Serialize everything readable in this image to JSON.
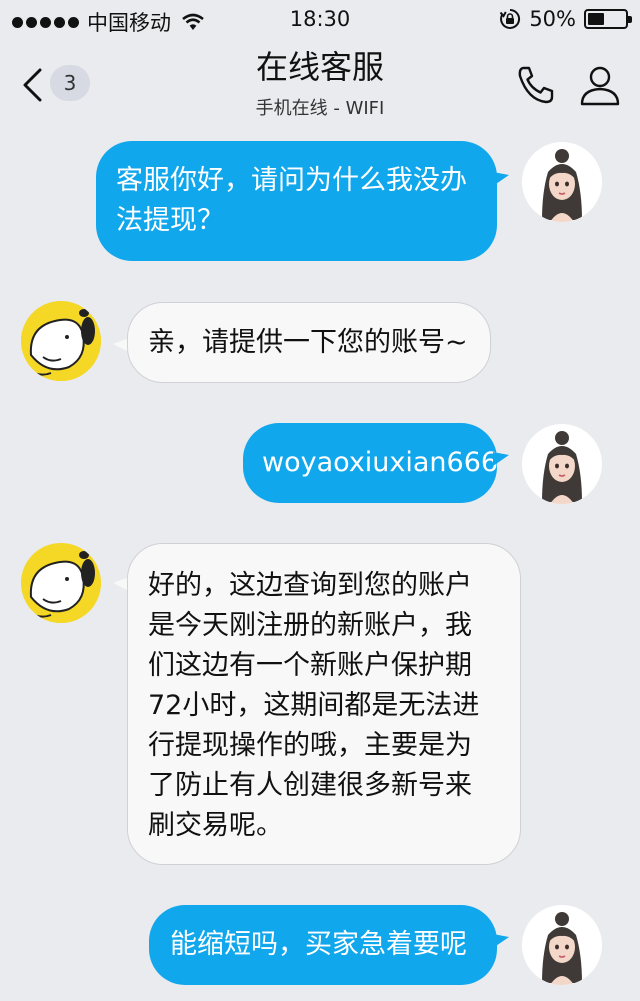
{
  "status_bar": {
    "carrier": "中国移动",
    "time": "18:30",
    "battery_text": "50%",
    "battery_level": 0.5
  },
  "nav": {
    "badge_count": "3",
    "title": "在线客服",
    "subtitle": "手机在线 - WIFI"
  },
  "messages": [
    {
      "side": "out",
      "text": "客服你好，请问为什么我没办法提现？"
    },
    {
      "side": "in",
      "text": "亲，请提供一下您的账号~"
    },
    {
      "side": "out",
      "text": "woyaoxiuxian666"
    },
    {
      "side": "in",
      "text": "好的，这边查询到您的账户是今天刚注册的新账户，我们这边有一个新账户保护期72小时，这期间都是无法进行提现操作的哦，主要是为了防止有人创建很多新号来刷交易呢。"
    },
    {
      "side": "out",
      "text": "能缩短吗，买家急着要呢"
    }
  ],
  "colors": {
    "background": "#eaebef",
    "outgoing_bubble": "#11a7ec",
    "incoming_bubble": "#f8f8f9"
  }
}
